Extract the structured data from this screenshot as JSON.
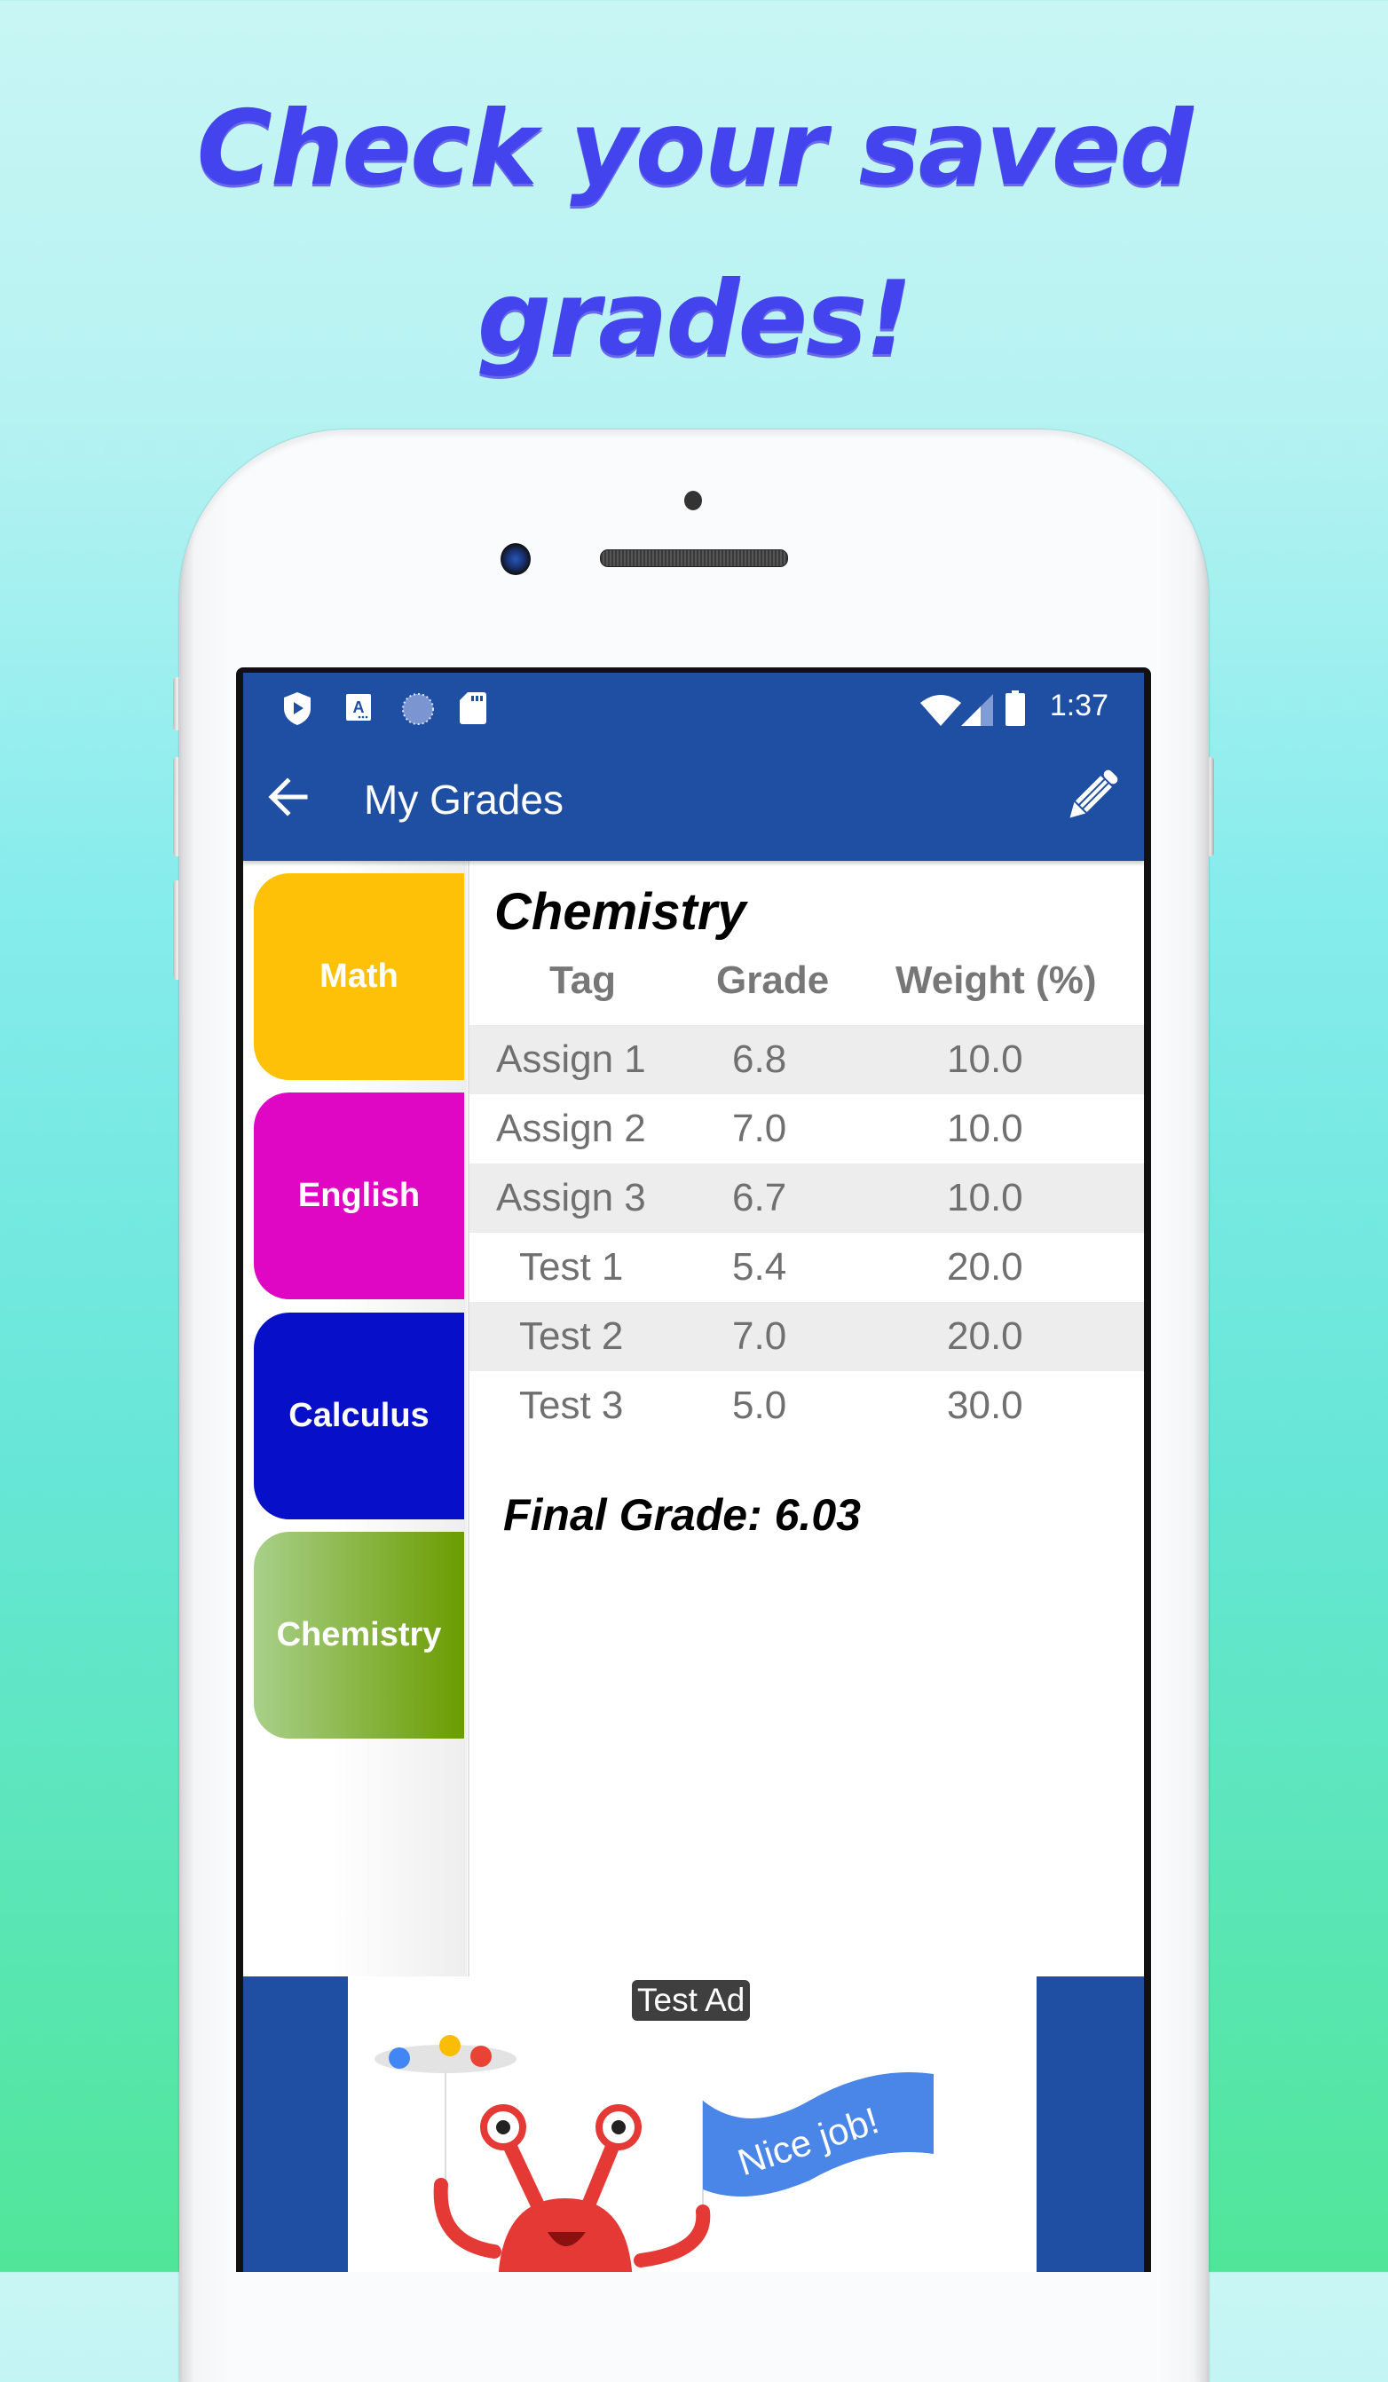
{
  "promo": {
    "headline_line1": "Check your saved",
    "headline_line2": "grades!"
  },
  "status_bar": {
    "time": "1:37",
    "left_icons": [
      "play-protect-icon",
      "accessibility-a-icon",
      "sync-loading-icon",
      "sd-card-icon"
    ],
    "right_icons": [
      "wifi-icon",
      "cell-signal-icon",
      "battery-icon"
    ]
  },
  "toolbar": {
    "title": "My Grades",
    "back_icon": "arrow-left-icon",
    "edit_icon": "pencil-icon"
  },
  "sidebar": {
    "tabs": [
      {
        "label": "Math",
        "color": "#ffc107"
      },
      {
        "label": "English",
        "color": "#e007c4"
      },
      {
        "label": "Calculus",
        "color": "#0710c8"
      },
      {
        "label": "Chemistry",
        "color_start": "#a8d08a",
        "color_end": "#6b9c00",
        "selected": true
      }
    ]
  },
  "grades": {
    "subject": "Chemistry",
    "columns": [
      "Tag",
      "Grade",
      "Weight (%)"
    ],
    "rows": [
      {
        "tag": "Assign 1",
        "grade": "6.8",
        "weight": "10.0"
      },
      {
        "tag": "Assign 2",
        "grade": "7.0",
        "weight": "10.0"
      },
      {
        "tag": "Assign 3",
        "grade": "6.7",
        "weight": "10.0"
      },
      {
        "tag": "Test 1",
        "grade": "5.4",
        "weight": "20.0"
      },
      {
        "tag": "Test 2",
        "grade": "7.0",
        "weight": "20.0"
      },
      {
        "tag": "Test 3",
        "grade": "5.0",
        "weight": "30.0"
      }
    ],
    "final_grade": "Final Grade: 6.03"
  },
  "ad": {
    "badge": "Test Ad",
    "banner_text": "Nice job!"
  },
  "colors": {
    "app_bar": "#1f4fa3",
    "headline": "#4444ee",
    "row_shade": "#ededed"
  }
}
